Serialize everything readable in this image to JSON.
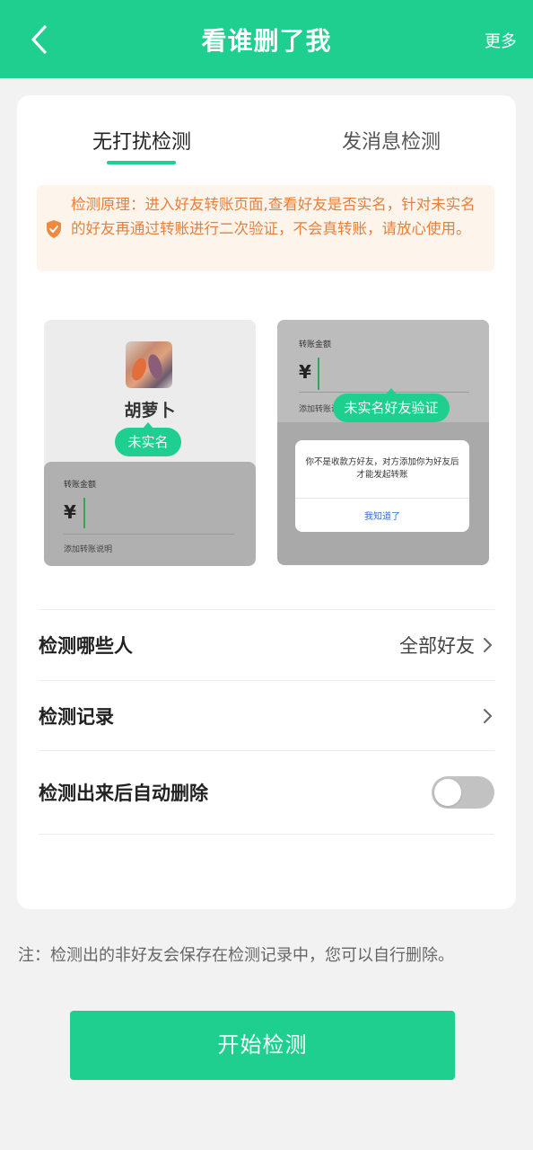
{
  "header": {
    "title": "看谁删了我",
    "more_label": "更多",
    "back_icon": "chevron-left-icon"
  },
  "tabs": [
    {
      "label": "无打扰检测",
      "active": true
    },
    {
      "label": "发消息检测",
      "active": false
    }
  ],
  "notice": {
    "icon": "shield-check-icon",
    "text": "检测原理：进入好友转账页面,查看好友是否实名，针对未实名的好友再通过转账进行二次验证，不会真转账，请放心使用。"
  },
  "illustration_left": {
    "friend_name": "胡萝卜",
    "badge": "未实名",
    "amount_label": "转账金额",
    "currency": "¥",
    "note_label": "添加转账说明"
  },
  "illustration_right": {
    "amount_label": "转账金额",
    "currency": "¥",
    "note_label": "添加转账说",
    "badge": "未实名好友验证",
    "dialog_message": "你不是收款方好友，对方添加你为好友后才能发起转账",
    "dialog_button": "我知道了"
  },
  "settings": {
    "who": {
      "label": "检测哪些人",
      "value": "全部好友"
    },
    "records": {
      "label": "检测记录"
    },
    "auto_delete": {
      "label": "检测出来后自动删除",
      "enabled": false
    }
  },
  "footnote": "注：检测出的非好友会保存在检测记录中，您可以自行删除。",
  "start_button": "开始检测",
  "colors": {
    "accent": "#1fcf8f",
    "notice_text": "#e8803a",
    "notice_bg": "#fdf4ec"
  }
}
